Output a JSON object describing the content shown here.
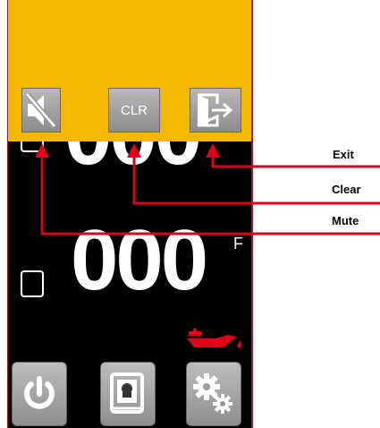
{
  "screen": {
    "top_digits": "000",
    "main_digits": "000",
    "unit": "F"
  },
  "header": {
    "mute_icon": "speaker-muted-icon",
    "clear_label": "CLR",
    "exit_icon": "exit-door-icon"
  },
  "status": {
    "oil_icon": "oil-can-icon",
    "oil_color": "#e0001a"
  },
  "soft_keys": [
    {
      "icon": "power-icon"
    },
    {
      "icon": "recipe-book-icon"
    },
    {
      "icon": "settings-gears-icon"
    }
  ],
  "callouts": [
    {
      "label": "Exit",
      "target": "exit-button"
    },
    {
      "label": "Clear",
      "target": "clear-button"
    },
    {
      "label": "Mute",
      "target": "mute-button"
    }
  ],
  "colors": {
    "header_panel": "#f5b800",
    "callout_line": "#e0001a",
    "screen_background": "#000000"
  }
}
